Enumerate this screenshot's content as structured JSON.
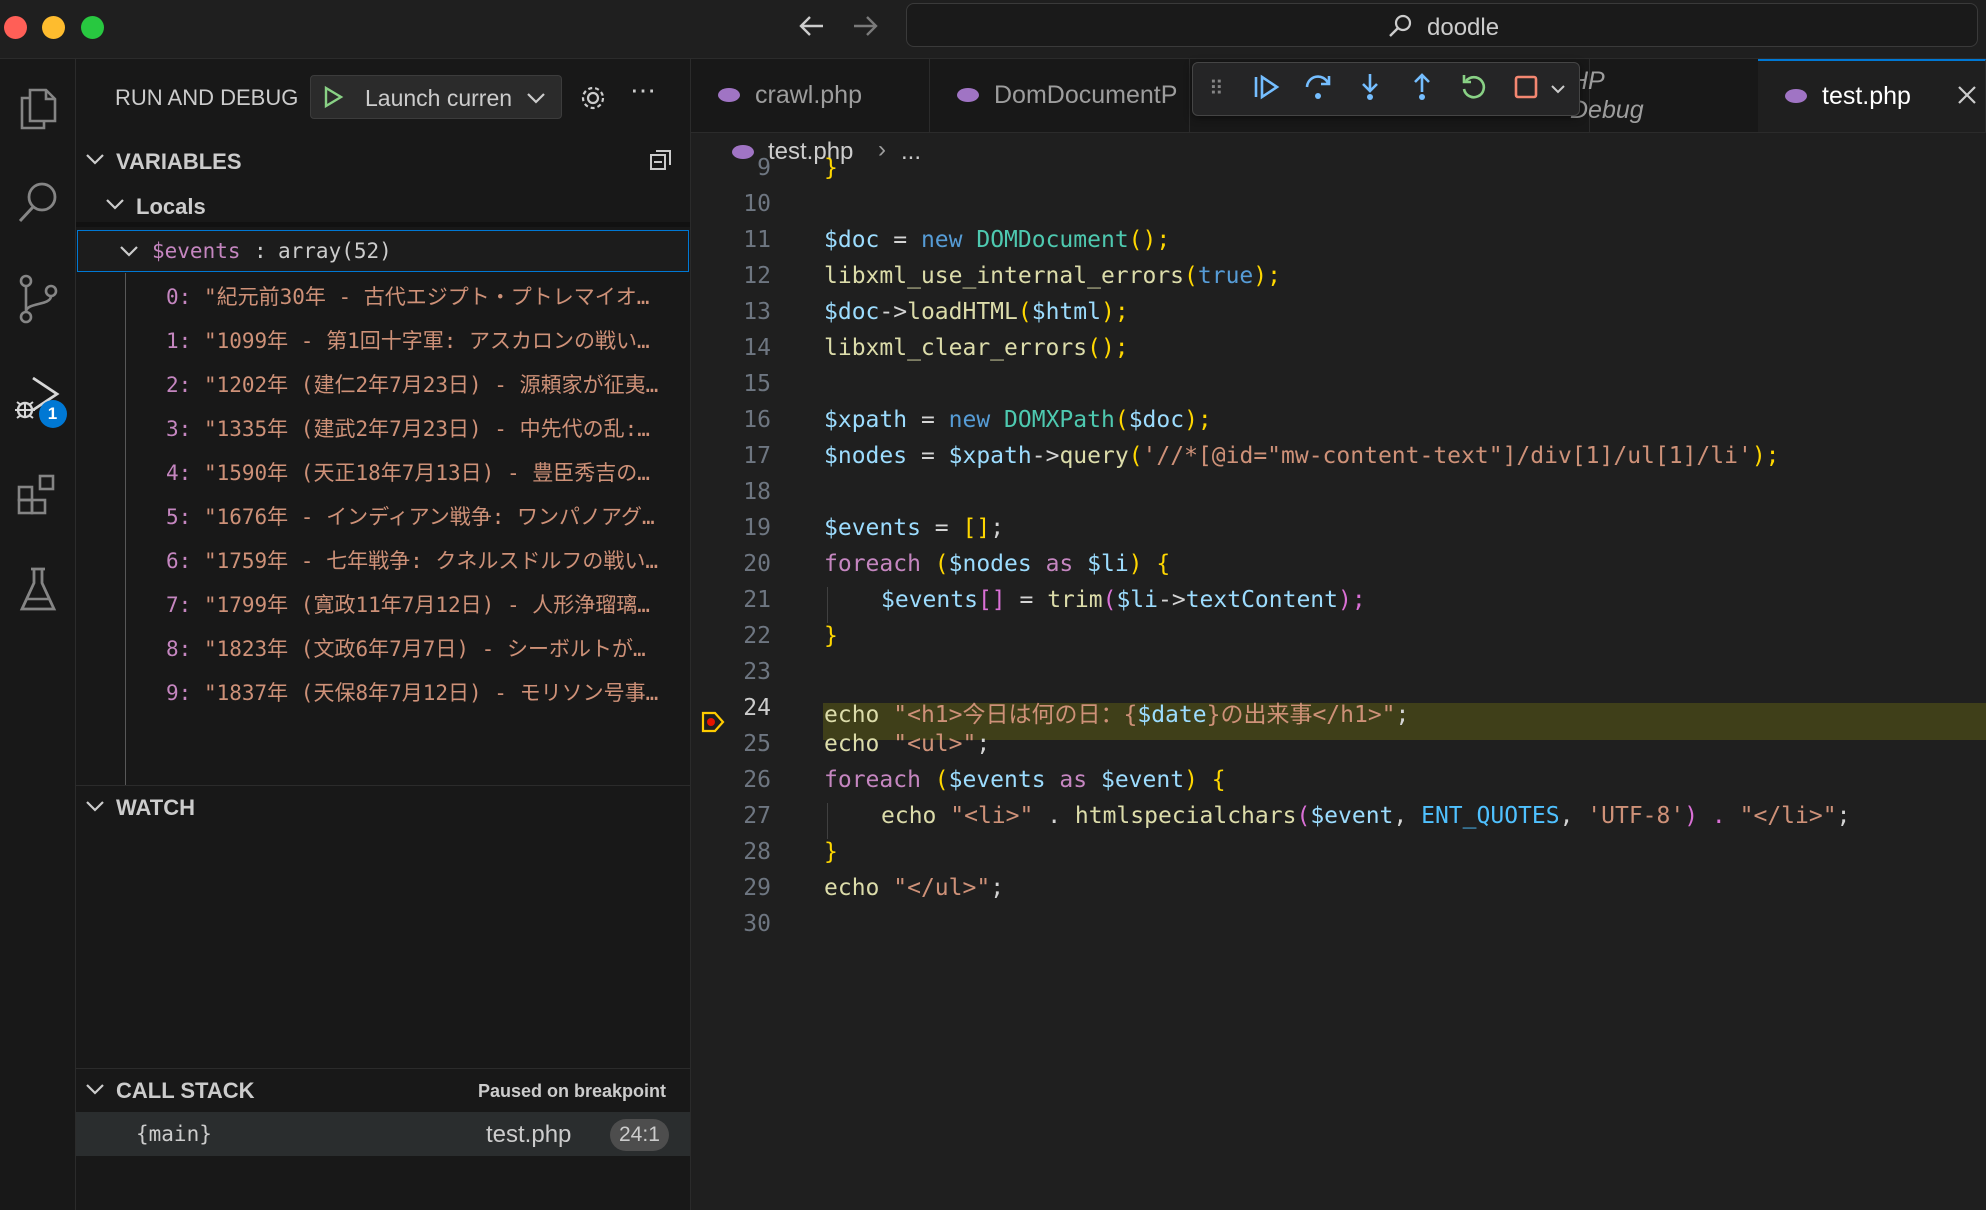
{
  "titlebar": {
    "traffic_colors": [
      "#ff5f57",
      "#febc2e",
      "#28c840"
    ],
    "search_text": "doodle"
  },
  "activity_bar": {
    "items": [
      {
        "icon": "files-icon"
      },
      {
        "icon": "search-icon"
      },
      {
        "icon": "source-control-icon"
      },
      {
        "icon": "run-debug-icon",
        "badge": "1"
      },
      {
        "icon": "extensions-icon"
      },
      {
        "icon": "testing-icon"
      }
    ]
  },
  "sidebar": {
    "title": "RUN AND DEBUG",
    "launch_config": "Launch curren",
    "variables": {
      "header": "VARIABLES",
      "locals_label": "Locals",
      "events_name": "$events",
      "events_type": "array(52)",
      "items": [
        {
          "index": "0:",
          "value": "\"紀元前30年 - 古代エジプト・プトレマイオ…"
        },
        {
          "index": "1:",
          "value": "\"1099年 - 第1回十字軍: アスカロンの戦い…"
        },
        {
          "index": "2:",
          "value": "\"1202年 (建仁2年7月23日) - 源頼家が征夷…"
        },
        {
          "index": "3:",
          "value": "\"1335年 (建武2年7月23日) - 中先代の乱:…"
        },
        {
          "index": "4:",
          "value": "\"1590年 (天正18年7月13日) - 豊臣秀吉の…"
        },
        {
          "index": "5:",
          "value": "\"1676年 - インディアン戦争: ワンパノアグ…"
        },
        {
          "index": "6:",
          "value": "\"1759年 - 七年戦争: クネルスドルフの戦い…"
        },
        {
          "index": "7:",
          "value": "\"1799年 (寛政11年7月12日) - 人形浄瑠璃…"
        },
        {
          "index": "8:",
          "value": "\"1823年 (文政6年7月7日) - シーボルトが…"
        },
        {
          "index": "9:",
          "value": "\"1837年 (天保8年7月12日) - モリソン号事…"
        }
      ]
    },
    "watch": {
      "header": "WATCH"
    },
    "call_stack": {
      "header": "CALL STACK",
      "status": "Paused on breakpoint",
      "frames": [
        {
          "name": "{main}",
          "file": "test.php",
          "pos": "24:1"
        }
      ]
    }
  },
  "editor": {
    "tabs": [
      {
        "label": "crawl.php"
      },
      {
        "label": "DomDocumentP"
      },
      {
        "label": "HP Debug"
      },
      {
        "label": "test.php",
        "active": true
      }
    ],
    "breadcrumb": {
      "file": "test.php",
      "rest": "..."
    },
    "line_numbers": [
      "9",
      "10",
      "11",
      "12",
      "13",
      "14",
      "15",
      "16",
      "17",
      "18",
      "19",
      "20",
      "21",
      "22",
      "23",
      "24",
      "25",
      "26",
      "27",
      "28",
      "29",
      "30"
    ],
    "current_line": "24",
    "code": {
      "l9": "}",
      "l11": [
        "$doc",
        " = ",
        "new",
        " ",
        "DOMDocument",
        "();"
      ],
      "l12": [
        "libxml_use_internal_errors",
        "(",
        "true",
        ");"
      ],
      "l13": [
        "$doc",
        "->",
        "loadHTML",
        "(",
        "$html",
        ");"
      ],
      "l14": [
        "libxml_clear_errors",
        "();"
      ],
      "l16": [
        "$xpath",
        " = ",
        "new",
        " ",
        "DOMXPath",
        "(",
        "$doc",
        ");"
      ],
      "l17": [
        "$nodes",
        " = ",
        "$xpath",
        "->",
        "query",
        "(",
        "'//*[@id=\"mw-content-text\"]/div[1]/ul[1]/li'",
        ");"
      ],
      "l19": [
        "$events",
        " = ",
        "[]",
        ";"
      ],
      "l20": [
        "foreach",
        " (",
        "$nodes",
        " as ",
        "$li",
        ") {"
      ],
      "l21": [
        "$events",
        "[]",
        " = ",
        "trim",
        "(",
        "$li",
        "->",
        "textContent",
        ");"
      ],
      "l22": "}",
      "l24": [
        "echo",
        " ",
        "\"<h1>今日は何の日：{",
        "$date",
        "}の出来事</h1>\"",
        ";"
      ],
      "l25": [
        "echo",
        " ",
        "\"<ul>\"",
        ";"
      ],
      "l26": [
        "foreach",
        " (",
        "$events",
        " as ",
        "$event",
        ") {"
      ],
      "l27": [
        "echo",
        " ",
        "\"<li>\"",
        " . ",
        "htmlspecialchars",
        "(",
        "$event",
        ", ",
        "ENT_QUOTES",
        ", ",
        "'UTF-8'",
        ") . ",
        "\"</li>\"",
        ";"
      ],
      "l28": "}",
      "l29": [
        "echo",
        " ",
        "\"</ul>\"",
        ";"
      ]
    }
  },
  "colors": {
    "accent": "#0078d4",
    "badge": "#0078d4",
    "breakpoint": "#ffcc00",
    "highlight": "#4b4b18"
  }
}
